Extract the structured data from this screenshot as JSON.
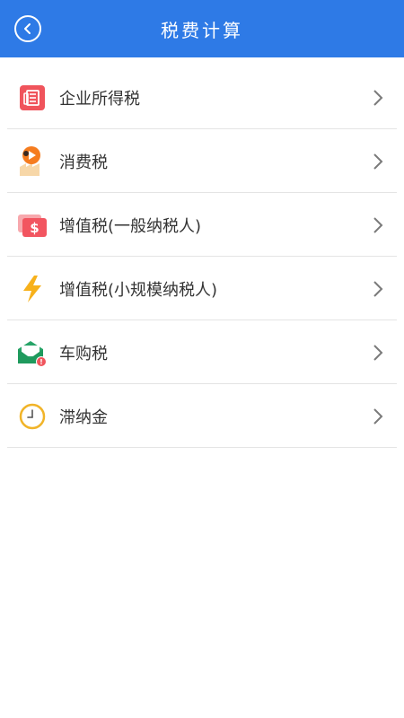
{
  "header": {
    "title": "税费计算",
    "background_color": "#2e7ae6",
    "back_icon": "back-arrow-circle-icon"
  },
  "items": [
    {
      "label": "企业所得税",
      "icon": "document-icon",
      "color": "#f0545c"
    },
    {
      "label": "消费税",
      "icon": "factory-play-icon",
      "color": "#f57c1f"
    },
    {
      "label": "增值税(一般纳税人)",
      "icon": "dollar-card-icon",
      "color": "#f25560"
    },
    {
      "label": "增值税(小规模纳税人)",
      "icon": "lightning-bolt-icon",
      "color": "#f7b11b"
    },
    {
      "label": "车购税",
      "icon": "envelope-badge-icon",
      "color": "#27a468"
    },
    {
      "label": "滞纳金",
      "icon": "clock-icon",
      "color": "#f1b429"
    }
  ],
  "chevron_icon": "chevron-right-icon"
}
